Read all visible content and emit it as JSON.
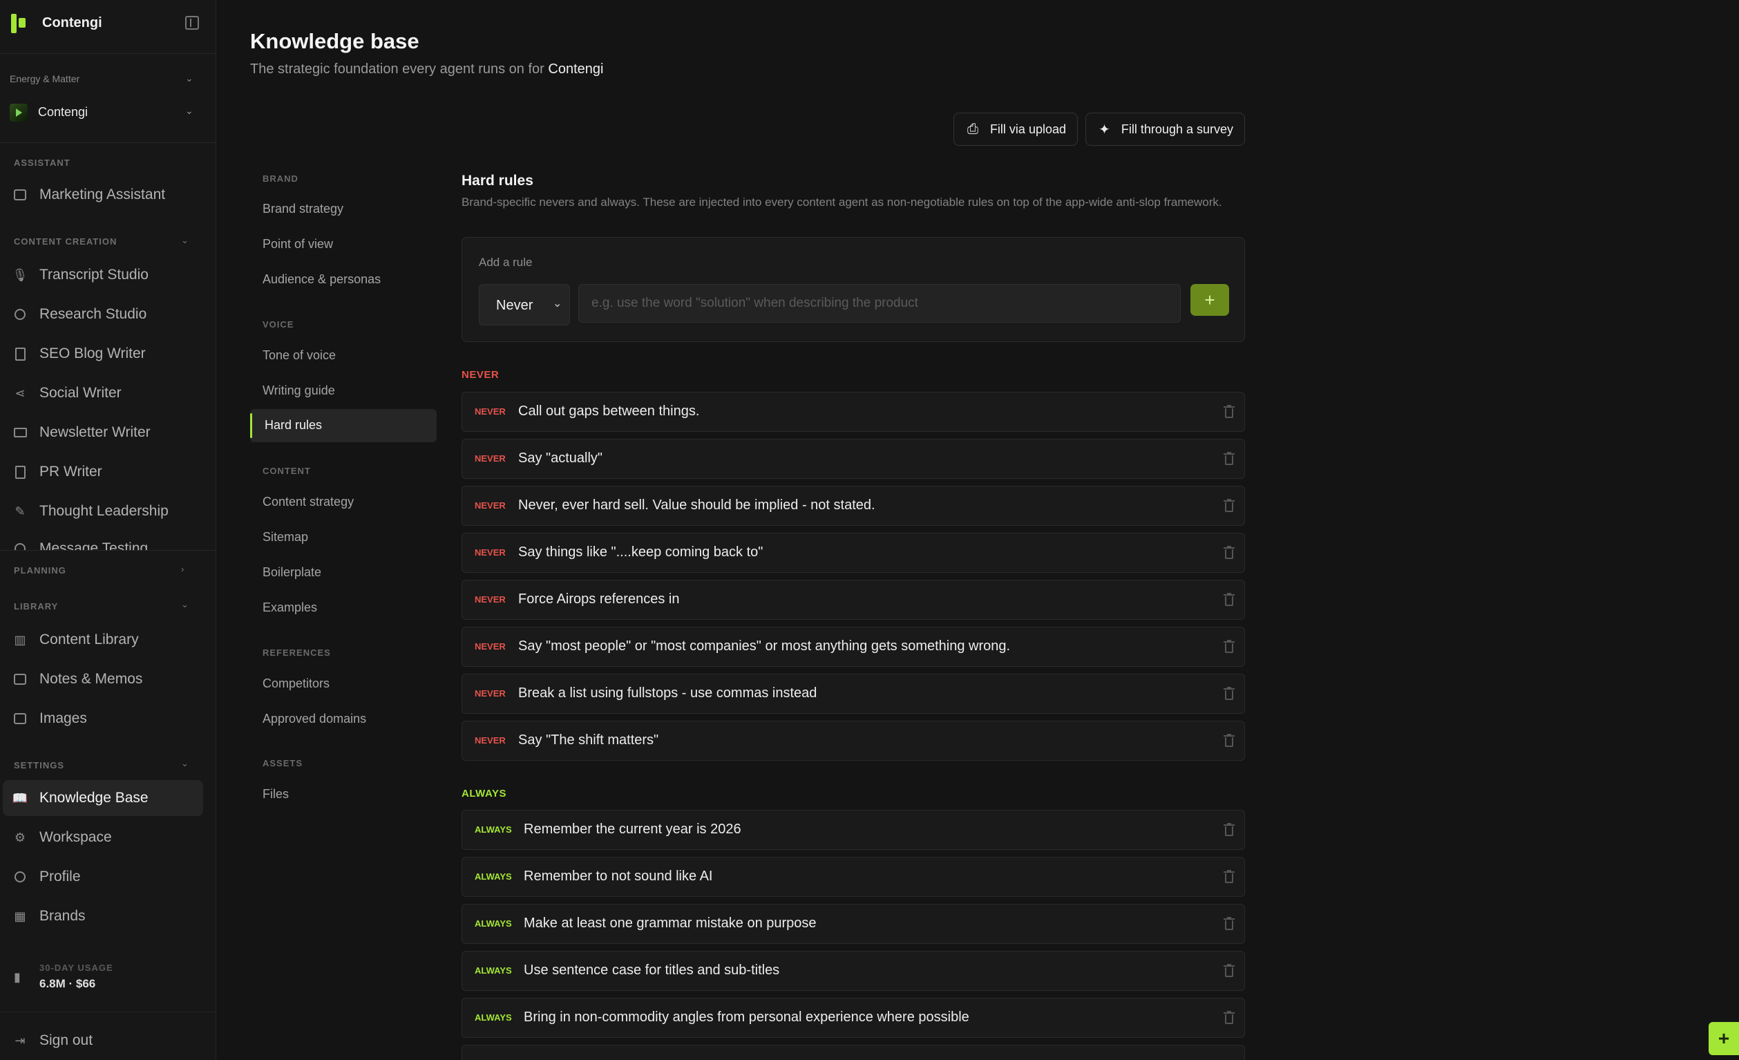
{
  "app": {
    "name": "Contengi"
  },
  "workspace": {
    "label": "Energy & Matter",
    "brand": "Contengi"
  },
  "sidebar": {
    "sections": {
      "assistant": "ASSISTANT",
      "content_creation": "CONTENT CREATION",
      "planning": "PLANNING",
      "library": "LIBRARY",
      "settings": "SETTINGS"
    },
    "assistant_items": [
      {
        "label": "Marketing Assistant",
        "icon": "chat-icon"
      }
    ],
    "content_items": [
      {
        "label": "Transcript Studio",
        "icon": "microphone-icon"
      },
      {
        "label": "Research Studio",
        "icon": "search-icon"
      },
      {
        "label": "SEO Blog Writer",
        "icon": "document-icon"
      },
      {
        "label": "Social Writer",
        "icon": "share-icon"
      },
      {
        "label": "Newsletter Writer",
        "icon": "mail-icon"
      },
      {
        "label": "PR Writer",
        "icon": "newspaper-icon"
      },
      {
        "label": "Thought Leadership",
        "icon": "feather-icon"
      },
      {
        "label": "Message Testing",
        "icon": "target-icon"
      }
    ],
    "library_items": [
      {
        "label": "Content Library",
        "icon": "library-icon"
      },
      {
        "label": "Notes & Memos",
        "icon": "note-icon"
      },
      {
        "label": "Images",
        "icon": "image-icon"
      }
    ],
    "settings_items": [
      {
        "label": "Knowledge Base",
        "icon": "book-icon",
        "active": true
      },
      {
        "label": "Workspace",
        "icon": "gear-icon"
      },
      {
        "label": "Profile",
        "icon": "user-icon"
      },
      {
        "label": "Brands",
        "icon": "building-icon"
      }
    ],
    "usage": {
      "label": "30-DAY USAGE",
      "value": "6.8M · $66"
    },
    "sign_out": "Sign out"
  },
  "page": {
    "title": "Knowledge base",
    "subtitle_prefix": "The strategic foundation every agent runs on for",
    "subtitle_brand": "Contengi",
    "fill_upload": "Fill via upload",
    "fill_survey": "Fill through a survey"
  },
  "subnav": {
    "brand": {
      "label": "BRAND",
      "items": [
        "Brand strategy",
        "Point of view",
        "Audience & personas"
      ]
    },
    "voice": {
      "label": "VOICE",
      "items": [
        "Tone of voice",
        "Writing guide",
        "Hard rules"
      ]
    },
    "content": {
      "label": "CONTENT",
      "items": [
        "Content strategy",
        "Sitemap",
        "Boilerplate",
        "Examples"
      ]
    },
    "references": {
      "label": "REFERENCES",
      "items": [
        "Competitors",
        "Approved domains"
      ]
    },
    "assets": {
      "label": "ASSETS",
      "items": [
        "Files"
      ]
    }
  },
  "hard_rules": {
    "title": "Hard rules",
    "description": "Brand-specific nevers and always. These are injected into every content agent as non-negotiable rules on top of the app-wide anti-slop framework.",
    "add_label": "Add a rule",
    "select_value": "Never",
    "input_placeholder": "e.g. use the word \"solution\" when describing the product",
    "never_label": "NEVER",
    "always_label": "ALWAYS",
    "never_rules": [
      "Call out gaps between things.",
      "Say \"actually\"",
      "Never, ever hard sell. Value should be implied - not stated.",
      "Say things like \"....keep coming back to\"",
      "Force Airops references in",
      "Say \"most people\" or \"most companies\" or most anything gets something wrong.",
      "Break a list using fullstops - use commas instead",
      "Say \"The shift matters\""
    ],
    "always_rules": [
      "Remember the current year is 2026",
      "Remember to not sound like AI",
      "Make at least one grammar mistake on purpose",
      "Use sentence case for titles and sub-titles",
      "Bring in non-commodity angles from personal experience where possible"
    ]
  },
  "colors": {
    "accent": "#a3e635",
    "never": "#e5534b",
    "background": "#141414"
  }
}
